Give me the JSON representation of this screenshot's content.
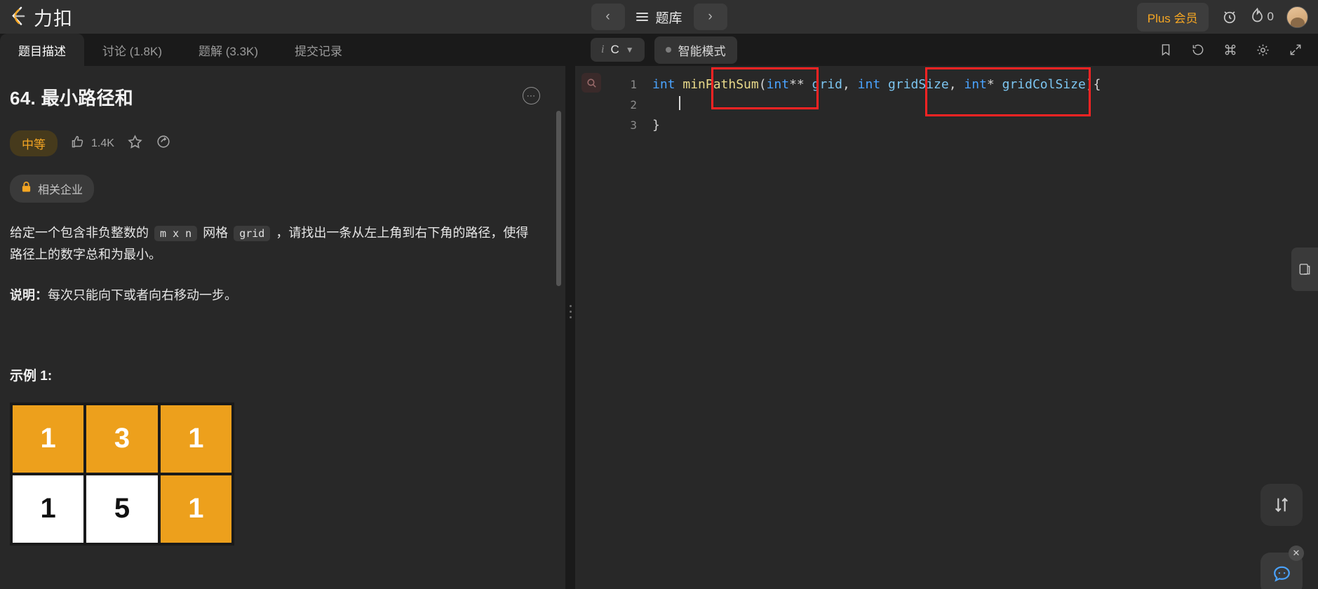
{
  "header": {
    "logo_text": "力扣",
    "logo_icon": "leetcode-logo-icon",
    "nav": {
      "back_icon": "chevron-left-icon",
      "forward_icon": "chevron-right-icon",
      "menu_icon": "hamburger-menu-icon",
      "title": "题库"
    },
    "plus_label": "Plus 会员",
    "timer_icon": "alarm-clock-icon",
    "streak_icon": "flame-icon",
    "streak_count": "0",
    "avatar_icon": "user-avatar"
  },
  "tabs": [
    {
      "label": "题目描述",
      "active": true
    },
    {
      "label": "讨论 (1.8K)",
      "active": false
    },
    {
      "label": "题解 (3.3K)",
      "active": false
    },
    {
      "label": "提交记录",
      "active": false
    }
  ],
  "problem": {
    "title": "64. 最小路径和",
    "more_icon": "ellipsis-icon",
    "difficulty": "中等",
    "like_icon": "thumbs-up-icon",
    "like_count": "1.4K",
    "star_icon": "star-icon",
    "share_icon": "share-icon",
    "company_tag": "相关企业",
    "lock_icon": "lock-icon",
    "desc_part1": "给定一个包含非负整数的",
    "desc_code1": "m x n",
    "desc_part2": "网格",
    "desc_code2": "grid",
    "desc_part3": "，请找出一条从左上角到右下角的路径，使得路径上的数字总和为最小。",
    "note_label": "说明：",
    "note_text": "每次只能向下或者向右移动一步。",
    "example_heading": "示例 1:"
  },
  "grid_example": {
    "rows": [
      [
        {
          "v": "1",
          "hl": true
        },
        {
          "v": "3",
          "hl": true
        },
        {
          "v": "1",
          "hl": true
        }
      ],
      [
        {
          "v": "1",
          "hl": false
        },
        {
          "v": "5",
          "hl": false
        },
        {
          "v": "1",
          "hl": true
        }
      ]
    ],
    "highlight_color": "#eda01c",
    "plain_color": "#ffffff"
  },
  "editor": {
    "lang_info_icon": "info-icon",
    "lang_name": "C",
    "lang_chevron": "chevron-down-icon",
    "smart_mode_label": "智能模式",
    "toolbar_icons": [
      "bookmark-icon",
      "reset-icon",
      "command-icon",
      "settings-gear-icon",
      "fullscreen-icon"
    ],
    "search_icon": "search-icon",
    "lines": [
      {
        "num": "1",
        "tokens": [
          {
            "t": "int",
            "c": "kw"
          },
          {
            "t": " ",
            "c": "def"
          },
          {
            "t": "minPathSum",
            "c": "fn"
          },
          {
            "t": "(",
            "c": "def"
          },
          {
            "t": "int",
            "c": "kw"
          },
          {
            "t": "** ",
            "c": "def"
          },
          {
            "t": "grid",
            "c": "pl"
          },
          {
            "t": ", ",
            "c": "def"
          },
          {
            "t": "int",
            "c": "kw"
          },
          {
            "t": " ",
            "c": "def"
          },
          {
            "t": "gridSize",
            "c": "pl"
          },
          {
            "t": ", ",
            "c": "def"
          },
          {
            "t": "int",
            "c": "kw"
          },
          {
            "t": "* ",
            "c": "def"
          },
          {
            "t": "gridColSize",
            "c": "pl"
          },
          {
            "t": "){",
            "c": "def"
          }
        ]
      },
      {
        "num": "2",
        "tokens": []
      },
      {
        "num": "3",
        "tokens": [
          {
            "t": "}",
            "c": "def"
          }
        ]
      }
    ],
    "annotation_color": "#ff2323"
  },
  "floating": {
    "panel_tab_icon": "panel-toggle-icon",
    "swap_icon": "swap-layout-icon",
    "chat_icon": "chat-bubble-icon",
    "close_icon": "close-icon"
  }
}
